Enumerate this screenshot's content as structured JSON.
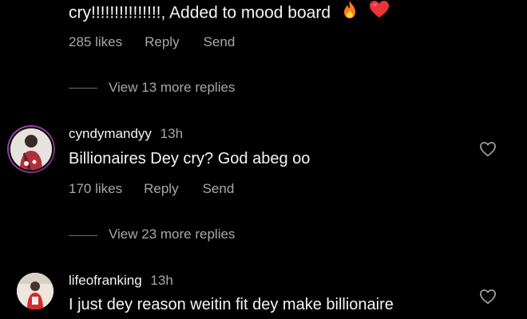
{
  "top_comment": {
    "text": "cry!!!!!!!!!!!!!!!, Added to mood board",
    "likes": "285 likes",
    "reply": "Reply",
    "send": "Send",
    "view_more": "View 13 more replies"
  },
  "comments": [
    {
      "username": "cyndymandyy",
      "time": "13h",
      "text": "Billionaires Dey cry? God abeg oo",
      "likes": "170 likes",
      "reply": "Reply",
      "send": "Send",
      "view_more": "View 23 more replies"
    },
    {
      "username": "lifeofranking",
      "time": "13h",
      "text": "I just dey reason weitin fit dey make billionaire"
    }
  ],
  "colors": {
    "background": "#000000",
    "primary_text": "#f5f5f5",
    "secondary_text": "#a8a8a8",
    "story_ring": "#8a3a8f"
  },
  "icons": {
    "like": "heart-outline-icon",
    "fire": "fire-emoji",
    "heart": "red-heart-emoji"
  }
}
